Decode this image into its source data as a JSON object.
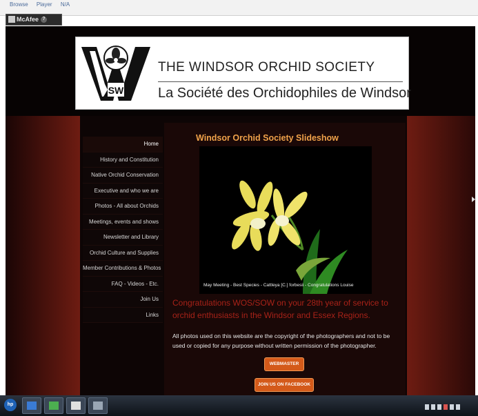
{
  "browser": {
    "links": [
      "Browse",
      "Player",
      "N/A"
    ],
    "mcafee_label": "McAfee"
  },
  "site": {
    "title_en": "THE WINDSOR ORCHID SOCIETY",
    "title_fr": "La Société des Orchidophiles de Windsor",
    "logo_letters": "WOSSOW"
  },
  "nav": {
    "items": [
      {
        "label": "Home"
      },
      {
        "label": "History and Constitution"
      },
      {
        "label": "Native Orchid Conservation"
      },
      {
        "label": "Executive and who we are"
      },
      {
        "label": "Photos - All about Orchids"
      },
      {
        "label": "Meetings, events and shows"
      },
      {
        "label": "Newsletter and Library"
      },
      {
        "label": "Orchid Culture and Supplies"
      },
      {
        "label": "Member Contributions & Photos"
      },
      {
        "label": "FAQ - Videos - Etc."
      },
      {
        "label": "Join Us"
      },
      {
        "label": "Links"
      }
    ]
  },
  "main": {
    "slideshow_title": "Windsor Orchid Society Slideshow",
    "slide_caption": "May Meeting - Best Species - Cattleya [C.] forbesii - Congratulations Louise",
    "congrats": "Congratulations WOS/SOW on your 28th year of service to orchid enthusiasts in the Windsor and Essex Regions.",
    "copyright": "All photos used on this website are the copyright of the photographers and not to be used or copied for any purpose without written permission of the photographer.",
    "webmaster_button": "WEBMASTER",
    "facebook_button": "JOIN US ON FACEBOOK"
  },
  "taskbar": {
    "start_label": "hp",
    "icons": [
      "checkbox-icon",
      "network-icon",
      "documents-icon",
      "media-icon"
    ]
  },
  "colors": {
    "accent_orange": "#f0a24a",
    "congrats_red": "#a82218",
    "button_orange": "#d45a1a",
    "page_dark": "#0d0505"
  }
}
